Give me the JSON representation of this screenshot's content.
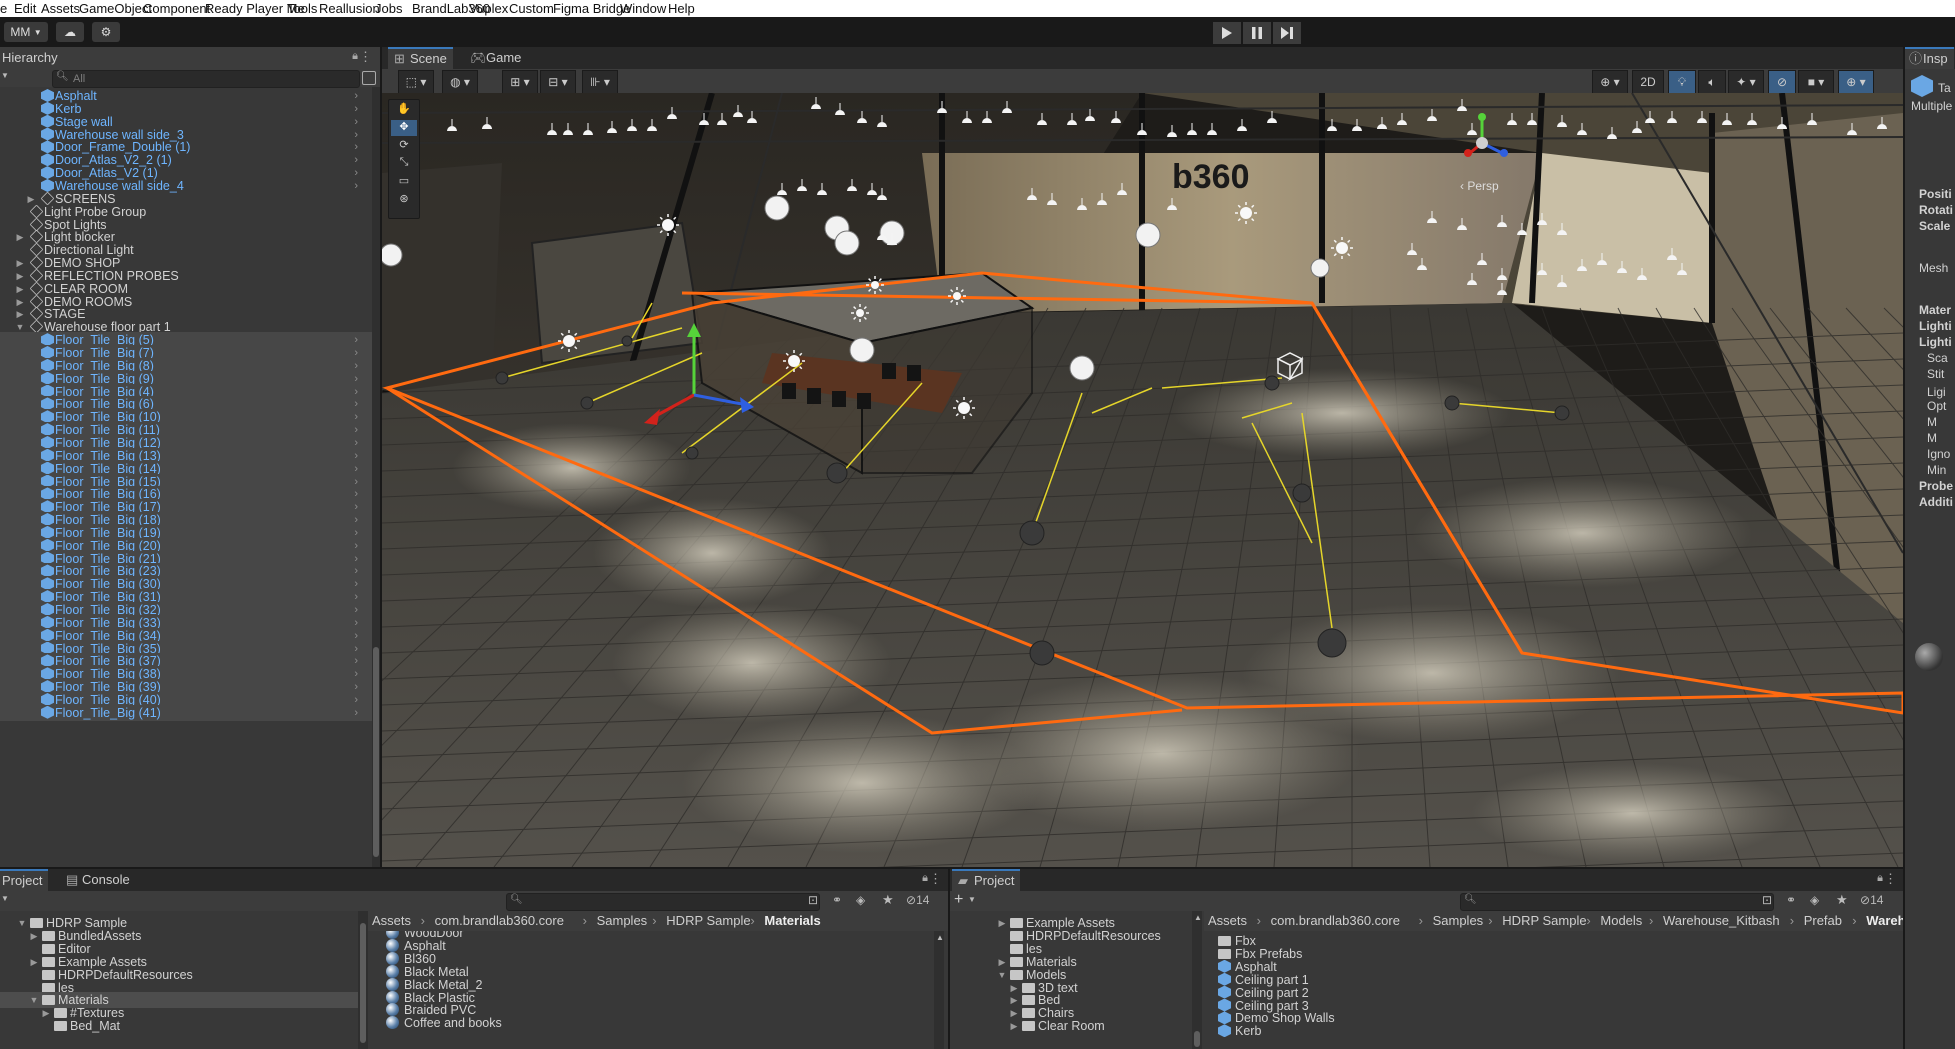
{
  "menu": [
    "e",
    "Edit",
    "Assets",
    "GameObject",
    "Component",
    "Ready Player Me",
    "Tools",
    "Reallusion",
    "Jobs",
    "BrandLab360",
    "Vuplex",
    "Custom",
    "Figma Bridge",
    "Window",
    "Help"
  ],
  "toolbar": {
    "account": "MM"
  },
  "hierarchy": {
    "title": "Hierarchy",
    "search_placeholder": "All",
    "items": [
      {
        "label": "Asphalt",
        "indent": 2,
        "style": "blue",
        "arrow": ""
      },
      {
        "label": "Kerb",
        "indent": 2,
        "style": "blue",
        "arrow": ""
      },
      {
        "label": "Stage wall",
        "indent": 2,
        "style": "blue",
        "arrow": ""
      },
      {
        "label": "Warehouse wall side_3",
        "indent": 2,
        "style": "blue",
        "arrow": ""
      },
      {
        "label": "Door_Frame_Double (1)",
        "indent": 2,
        "style": "blue",
        "arrow": ""
      },
      {
        "label": "Door_Atlas_V2_2 (1)",
        "indent": 2,
        "style": "blue",
        "arrow": ""
      },
      {
        "label": "Door_Atlas_V2 (1)",
        "indent": 2,
        "style": "blue",
        "arrow": ""
      },
      {
        "label": "Warehouse wall side_4",
        "indent": 2,
        "style": "blue",
        "arrow": ""
      },
      {
        "label": "SCREENS",
        "indent": 2,
        "style": "go",
        "arrow": "▶"
      },
      {
        "label": "Light Probe Group",
        "indent": 1,
        "style": "go",
        "arrow": ""
      },
      {
        "label": "Spot Lights",
        "indent": 1,
        "style": "go",
        "arrow": ""
      },
      {
        "label": "Light blocker",
        "indent": 1,
        "style": "go",
        "arrow": "▶"
      },
      {
        "label": "Directional Light",
        "indent": 1,
        "style": "go",
        "arrow": ""
      },
      {
        "label": "DEMO SHOP",
        "indent": 1,
        "style": "go",
        "arrow": "▶"
      },
      {
        "label": "REFLECTION PROBES",
        "indent": 1,
        "style": "go",
        "arrow": "▶"
      },
      {
        "label": "CLEAR ROOM",
        "indent": 1,
        "style": "go",
        "arrow": "▶"
      },
      {
        "label": "DEMO ROOMS",
        "indent": 1,
        "style": "go",
        "arrow": "▶"
      },
      {
        "label": "STAGE",
        "indent": 1,
        "style": "go",
        "arrow": "▶"
      },
      {
        "label": "Warehouse floor part 1",
        "indent": 1,
        "style": "go",
        "arrow": "▼"
      },
      {
        "label": "Floor_Tile_Big (5)",
        "indent": 2,
        "style": "blue",
        "arrow": ""
      },
      {
        "label": "Floor_Tile_Big (7)",
        "indent": 2,
        "style": "blue",
        "arrow": ""
      },
      {
        "label": "Floor_Tile_Big (8)",
        "indent": 2,
        "style": "blue",
        "arrow": ""
      },
      {
        "label": "Floor_Tile_Big (9)",
        "indent": 2,
        "style": "blue",
        "arrow": ""
      },
      {
        "label": "Floor_Tile_Big (4)",
        "indent": 2,
        "style": "blue",
        "arrow": ""
      },
      {
        "label": "Floor_Tile_Big (6)",
        "indent": 2,
        "style": "blue",
        "arrow": ""
      },
      {
        "label": "Floor_Tile_Big (10)",
        "indent": 2,
        "style": "blue",
        "arrow": ""
      },
      {
        "label": "Floor_Tile_Big (11)",
        "indent": 2,
        "style": "blue",
        "arrow": ""
      },
      {
        "label": "Floor_Tile_Big (12)",
        "indent": 2,
        "style": "blue",
        "arrow": ""
      },
      {
        "label": "Floor_Tile_Big (13)",
        "indent": 2,
        "style": "blue",
        "arrow": ""
      },
      {
        "label": "Floor_Tile_Big (14)",
        "indent": 2,
        "style": "blue",
        "arrow": ""
      },
      {
        "label": "Floor_Tile_Big (15)",
        "indent": 2,
        "style": "blue",
        "arrow": ""
      },
      {
        "label": "Floor_Tile_Big (16)",
        "indent": 2,
        "style": "blue",
        "arrow": ""
      },
      {
        "label": "Floor_Tile_Big (17)",
        "indent": 2,
        "style": "blue",
        "arrow": ""
      },
      {
        "label": "Floor_Tile_Big (18)",
        "indent": 2,
        "style": "blue",
        "arrow": ""
      },
      {
        "label": "Floor_Tile_Big (19)",
        "indent": 2,
        "style": "blue",
        "arrow": ""
      },
      {
        "label": "Floor_Tile_Big (20)",
        "indent": 2,
        "style": "blue",
        "arrow": ""
      },
      {
        "label": "Floor_Tile_Big (21)",
        "indent": 2,
        "style": "blue",
        "arrow": ""
      },
      {
        "label": "Floor_Tile_Big (23)",
        "indent": 2,
        "style": "blue",
        "arrow": ""
      },
      {
        "label": "Floor_Tile_Big (30)",
        "indent": 2,
        "style": "blue",
        "arrow": ""
      },
      {
        "label": "Floor_Tile_Big (31)",
        "indent": 2,
        "style": "blue",
        "arrow": ""
      },
      {
        "label": "Floor_Tile_Big (32)",
        "indent": 2,
        "style": "blue",
        "arrow": ""
      },
      {
        "label": "Floor_Tile_Big (33)",
        "indent": 2,
        "style": "blue",
        "arrow": ""
      },
      {
        "label": "Floor_Tile_Big (34)",
        "indent": 2,
        "style": "blue",
        "arrow": ""
      },
      {
        "label": "Floor_Tile_Big (35)",
        "indent": 2,
        "style": "blue",
        "arrow": ""
      },
      {
        "label": "Floor_Tile_Big (37)",
        "indent": 2,
        "style": "blue",
        "arrow": ""
      },
      {
        "label": "Floor_Tile_Big (38)",
        "indent": 2,
        "style": "blue",
        "arrow": ""
      },
      {
        "label": "Floor_Tile_Big (39)",
        "indent": 2,
        "style": "blue",
        "arrow": ""
      },
      {
        "label": "Floor_Tile_Big (40)",
        "indent": 2,
        "style": "blue",
        "arrow": ""
      },
      {
        "label": "Floor_Tile_Big (41)",
        "indent": 2,
        "style": "blue",
        "arrow": ""
      }
    ]
  },
  "scene_tabs": {
    "scene": "Scene",
    "game": "Game"
  },
  "scene_toolbar": {
    "mode_2d": "2D"
  },
  "scene_view": {
    "projection": "Persp",
    "wall_text": "b360"
  },
  "inspector": {
    "tab": "Insp",
    "header_partial": "Ta",
    "multiple": "Multiple",
    "rows": [
      "Positi",
      "Rotati",
      "Scale",
      "Mesh",
      "Mater",
      "Lighti",
      "Lighti",
      "Sca",
      "Stit",
      "Ligi",
      "Opt",
      "M",
      "M",
      "Igno",
      "Min",
      "Probe",
      "Additi"
    ]
  },
  "project_left": {
    "tabs": [
      "Project",
      "Console"
    ],
    "search_placeholder": "",
    "count": "14",
    "tree": [
      {
        "label": "HDRP Sample",
        "indent": 1,
        "arrow": "▼"
      },
      {
        "label": "BundledAssets",
        "indent": 2,
        "arrow": "▶"
      },
      {
        "label": "Editor",
        "indent": 2,
        "arrow": ""
      },
      {
        "label": "Example Assets",
        "indent": 2,
        "arrow": "▶"
      },
      {
        "label": "HDRPDefaultResources",
        "indent": 2,
        "arrow": ""
      },
      {
        "label": "les",
        "indent": 2,
        "arrow": ""
      },
      {
        "label": "Materials",
        "indent": 2,
        "arrow": "▼",
        "selected": true
      },
      {
        "label": "#Textures",
        "indent": 3,
        "arrow": "▶"
      },
      {
        "label": "Bed_Mat",
        "indent": 3,
        "arrow": ""
      }
    ],
    "breadcrumb": [
      "Assets",
      "com.brandlab360.core",
      "Samples",
      "HDRP Sample",
      "Materials"
    ],
    "assets": [
      "WoodDoor",
      "Asphalt",
      "Bl360",
      "Black Metal",
      "Black Metal_2",
      "Black Plastic",
      "Braided PVC",
      "Coffee and books"
    ]
  },
  "project_right": {
    "tab": "Project",
    "count": "14",
    "tree": [
      {
        "label": "Example Assets",
        "indent": 1,
        "arrow": "▶"
      },
      {
        "label": "HDRPDefaultResources",
        "indent": 1,
        "arrow": ""
      },
      {
        "label": "les",
        "indent": 1,
        "arrow": ""
      },
      {
        "label": "Materials",
        "indent": 1,
        "arrow": "▶"
      },
      {
        "label": "Models",
        "indent": 1,
        "arrow": "▼"
      },
      {
        "label": "3D text",
        "indent": 2,
        "arrow": "▶"
      },
      {
        "label": "Bed",
        "indent": 2,
        "arrow": "▶"
      },
      {
        "label": "Chairs",
        "indent": 2,
        "arrow": "▶"
      },
      {
        "label": "Clear Room",
        "indent": 2,
        "arrow": "▶"
      }
    ],
    "breadcrumb": [
      "Assets",
      "com.brandlab360.core",
      "Samples",
      "HDRP Sample",
      "Models",
      "Warehouse_Kitbash",
      "Prefab",
      "Warehouse Sec"
    ],
    "assets": [
      {
        "label": "Fbx",
        "kind": "folder"
      },
      {
        "label": "Fbx Prefabs",
        "kind": "folder"
      },
      {
        "label": "Asphalt",
        "kind": "prefab"
      },
      {
        "label": "Ceiling part 1",
        "kind": "prefab"
      },
      {
        "label": "Ceiling part 2",
        "kind": "prefab"
      },
      {
        "label": "Ceiling part 3",
        "kind": "prefab"
      },
      {
        "label": "Demo Shop Walls",
        "kind": "prefab"
      },
      {
        "label": "Kerb",
        "kind": "prefab"
      }
    ]
  },
  "colors": {
    "selection_orange": "#ff6a10",
    "prefab_blue": "#6eb5ff",
    "accent": "#3a79bb"
  }
}
